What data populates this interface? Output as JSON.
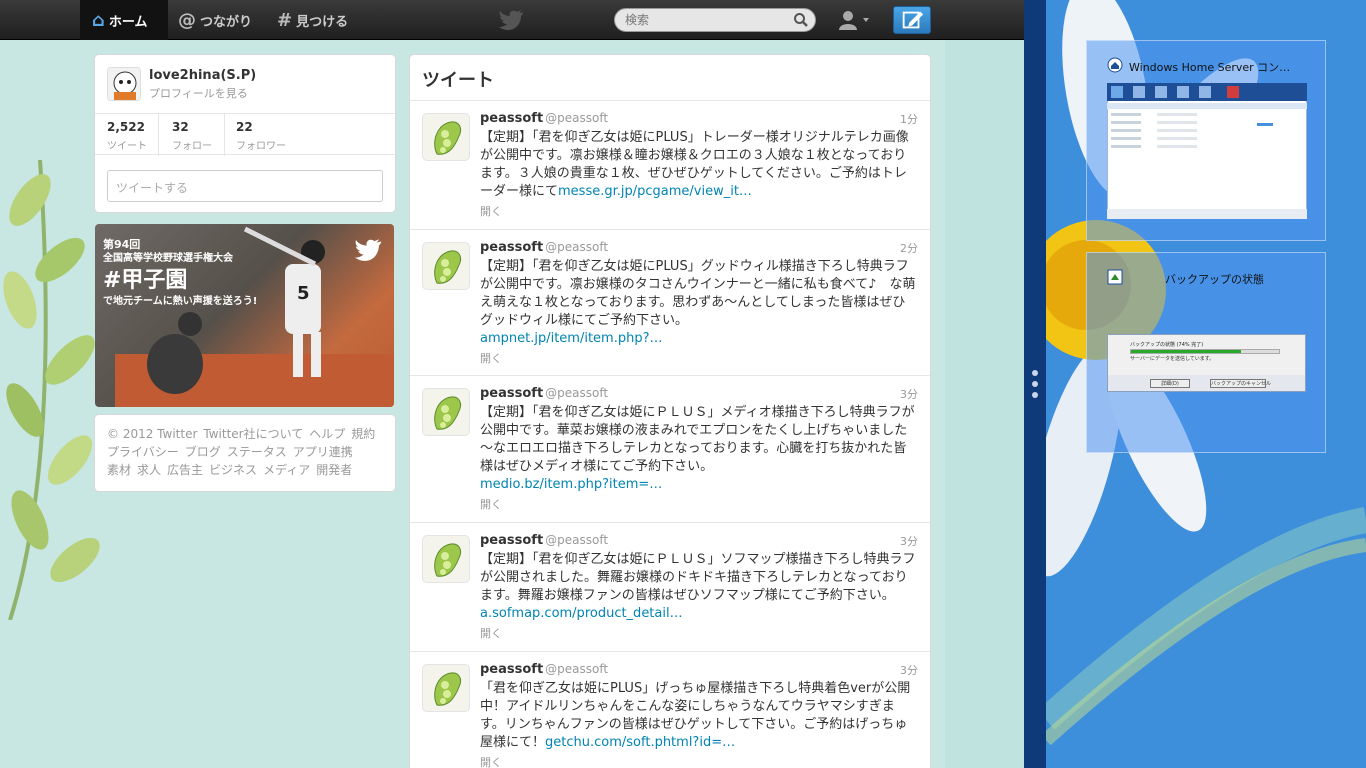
{
  "nav": {
    "home": "ホーム",
    "connect": "つながり",
    "discover": "見つける"
  },
  "search": {
    "placeholder": "検索"
  },
  "profile": {
    "name": "love2hina(S.P)",
    "link": "プロフィールを見る",
    "stats": [
      {
        "num": "2,522",
        "label": "ツイート"
      },
      {
        "num": "32",
        "label": "フォロー"
      },
      {
        "num": "22",
        "label": "フォロワー"
      }
    ],
    "compose_placeholder": "ツイートする"
  },
  "banner": {
    "line1": "第94回",
    "line2": "全国高等学校野球選手権大会",
    "line3": "#甲子園",
    "line4": "で地元チームに熱い声援を送ろう!"
  },
  "footer": {
    "links": [
      "© 2012 Twitter",
      "Twitter社について",
      "ヘルプ",
      "規約",
      "プライバシー",
      "ブログ",
      "ステータス",
      "アプリ連携",
      "素材",
      "求人",
      "広告主",
      "ビジネス",
      "メディア",
      "開発者"
    ]
  },
  "stream": {
    "title": "ツイート",
    "expand": "開く",
    "tweets": [
      {
        "name": "peassoft",
        "handle": "@peassoft",
        "time": "1分",
        "text": "【定期】「君を仰ぎ乙女は姫にPLUS」トレーダー様オリジナルテレカ画像が公開中です。凛お嬢様＆瞳お嬢様＆クロエの３人娘な１枚となっております。３人娘の貴重な１枚、ぜひぜひゲットしてください。ご予約はトレーダー様にて",
        "link": "messe.gr.jp/pcgame/view_it…"
      },
      {
        "name": "peassoft",
        "handle": "@peassoft",
        "time": "2分",
        "text": "【定期】「君を仰ぎ乙女は姫にPLUS」グッドウィル様描き下ろし特典ラフが公開中です。凛お嬢様のタコさんウインナーと一緒に私も食べて♪　な萌え萌えな１枚となっております。思わずあ～んとしてしまった皆様はぜひグッドウィル様にてご予約下さい。",
        "link": "ampnet.jp/item/item.php?…"
      },
      {
        "name": "peassoft",
        "handle": "@peassoft",
        "time": "3分",
        "text": "【定期】「君を仰ぎ乙女は姫にＰＬＵＳ」メディオ様描き下ろし特典ラフが公開中です。華菜お嬢様の液まみれでエプロンをたくし上げちゃいました～なエロエロ描き下ろしテレカとなっております。心臓を打ち抜かれた皆様はぜひメディオ様にてご予約下さい。",
        "link": "medio.bz/item.php?item=…"
      },
      {
        "name": "peassoft",
        "handle": "@peassoft",
        "time": "3分",
        "text": "【定期】「君を仰ぎ乙女は姫にＰＬＵＳ」ソフマップ様描き下ろし特典ラフが公開されました。舞羅お嬢様のドキドキ描き下ろしテレカとなっております。舞羅お嬢様ファンの皆様はぜひソフマップ様にてご予約下さい。",
        "link": "a.sofmap.com/product_detail…"
      },
      {
        "name": "peassoft",
        "handle": "@peassoft",
        "time": "3分",
        "text": "「君を仰ぎ乙女は姫にPLUS」げっちゅ屋様描き下ろし特典着色verが公開中！アイドルリンちゃんをこんな姿にしちゃうなんてウラヤマシすぎます。リンちゃんファンの皆様はぜひゲットして下さい。ご予約はげっちゅ屋様にて！",
        "link": "getchu.com/soft.phtml?id=…"
      }
    ]
  },
  "desktop": {
    "thumb1_title": "Windows Home Server コン…",
    "thumb2_title": "バックアップの状態",
    "backup_status": "バックアップの状態 (74% 完了)",
    "backup_progress": 0.74,
    "backup_line2": "サーバーにデータを送信しています。",
    "backup_btn1": "詳細(D)",
    "backup_btn2": "バックアップのキャンセル"
  },
  "colors": {
    "twitter_bg": "#c8e6e2",
    "link": "#0084b4",
    "desktop_bg": "#3d8fdc"
  }
}
